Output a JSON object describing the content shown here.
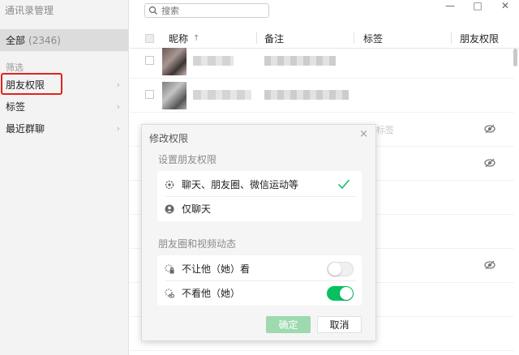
{
  "sidebar": {
    "title": "通讯录管理",
    "all_label": "全部",
    "all_count": "(2346)",
    "filter_label": "筛选",
    "items": [
      {
        "label": "朋友权限"
      },
      {
        "label": "标签"
      },
      {
        "label": "最近群聊"
      }
    ]
  },
  "search": {
    "placeholder": "搜索"
  },
  "window": {
    "minimize": "—",
    "maximize": "□",
    "close": "✕"
  },
  "table": {
    "headers": {
      "nickname": "昵称",
      "sort_indicator": "↑",
      "note": "备注",
      "tag": "标签",
      "permission": "朋友权限"
    },
    "partial_text": "标签"
  },
  "dialog": {
    "title": "修改权限",
    "close": "×",
    "section1_label": "设置朋友权限",
    "options": [
      {
        "label": "聊天、朋友圈、微信运动等",
        "icon": "chat-all-icon"
      },
      {
        "label": "仅聊天",
        "icon": "chat-only-icon"
      }
    ],
    "section2_label": "朋友圈和视频动态",
    "toggles": [
      {
        "label": "不让他（她）看",
        "state": "off"
      },
      {
        "label": "不看他（她）",
        "state": "on"
      }
    ],
    "ok_label": "确定",
    "cancel_label": "取消"
  },
  "colors": {
    "accent_green": "#07c160",
    "highlight_red": "#e0241b",
    "ok_disabled": "#9ed9af"
  }
}
